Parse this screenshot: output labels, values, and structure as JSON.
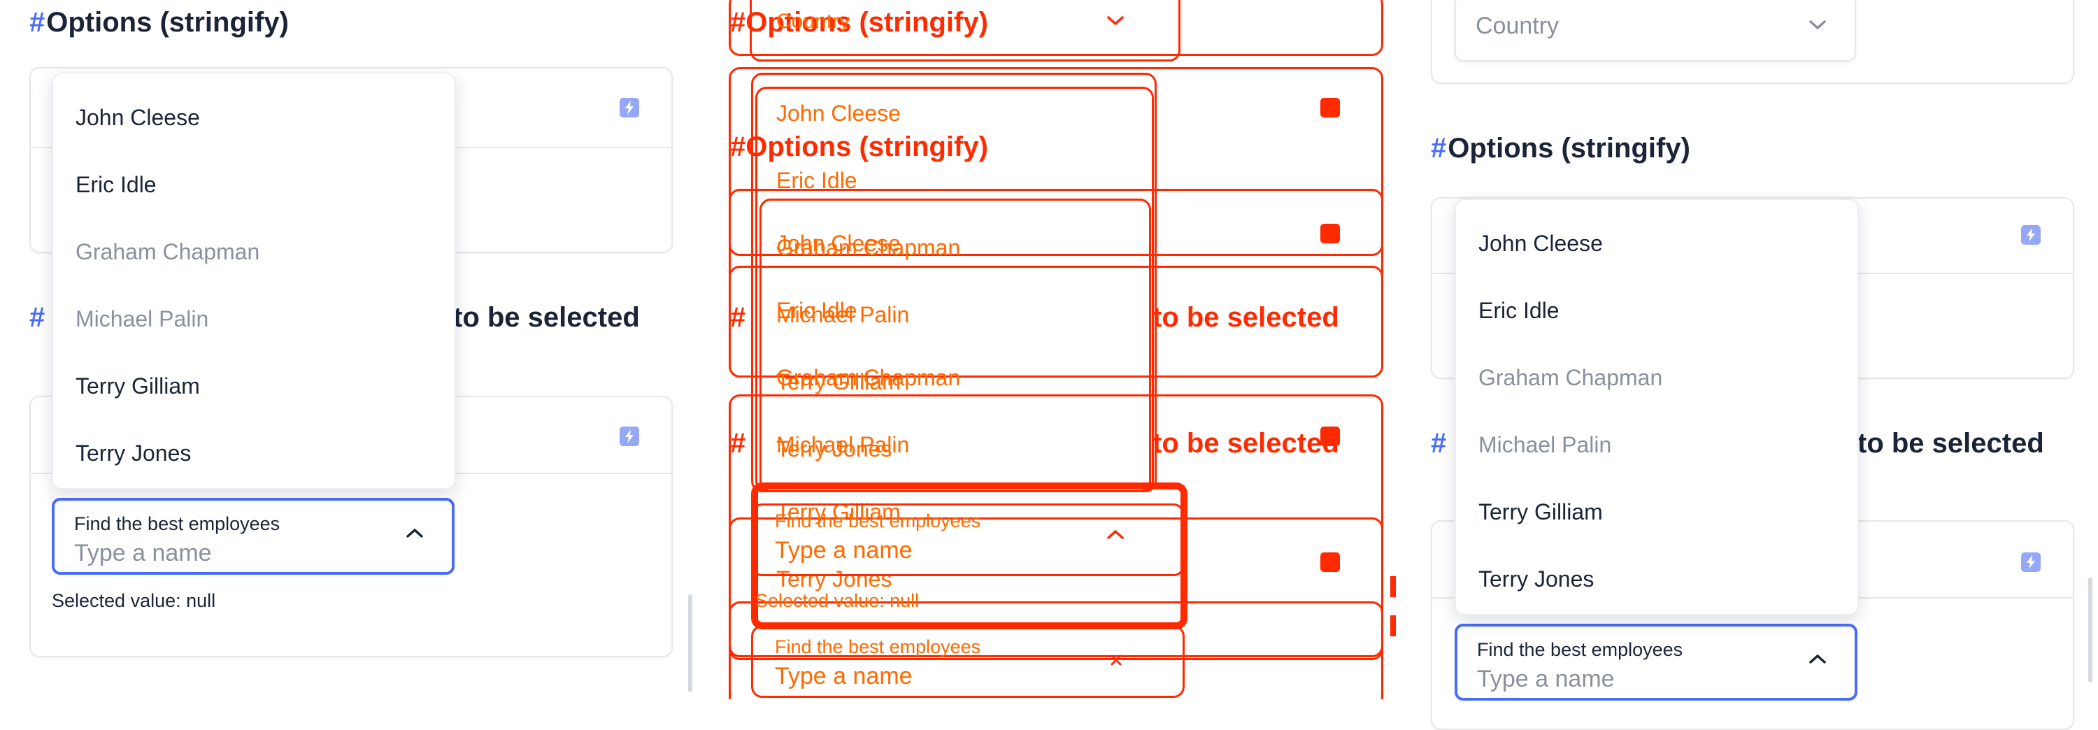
{
  "sections": {
    "options_stringify": "Options (stringify)",
    "to_be_selected_suffix": "to be selected"
  },
  "hash": "#",
  "dropdown": {
    "options": [
      "John Cleese",
      "Eric Idle",
      "Graham Chapman",
      "Michael Palin",
      "Terry Gilliam",
      "Terry Jones"
    ]
  },
  "employee_select": {
    "label": "Find the best employees",
    "placeholder": "Type a name"
  },
  "country_select": {
    "placeholder": "Country"
  },
  "selected_value": "Selected value: null",
  "colors": {
    "accent": "#4a6cf7",
    "overlay_red": "#ff2a00",
    "overlay_orange": "#ff6a00"
  },
  "icons": [
    "lightning-icon",
    "chevron-up-icon",
    "chevron-down-icon"
  ]
}
